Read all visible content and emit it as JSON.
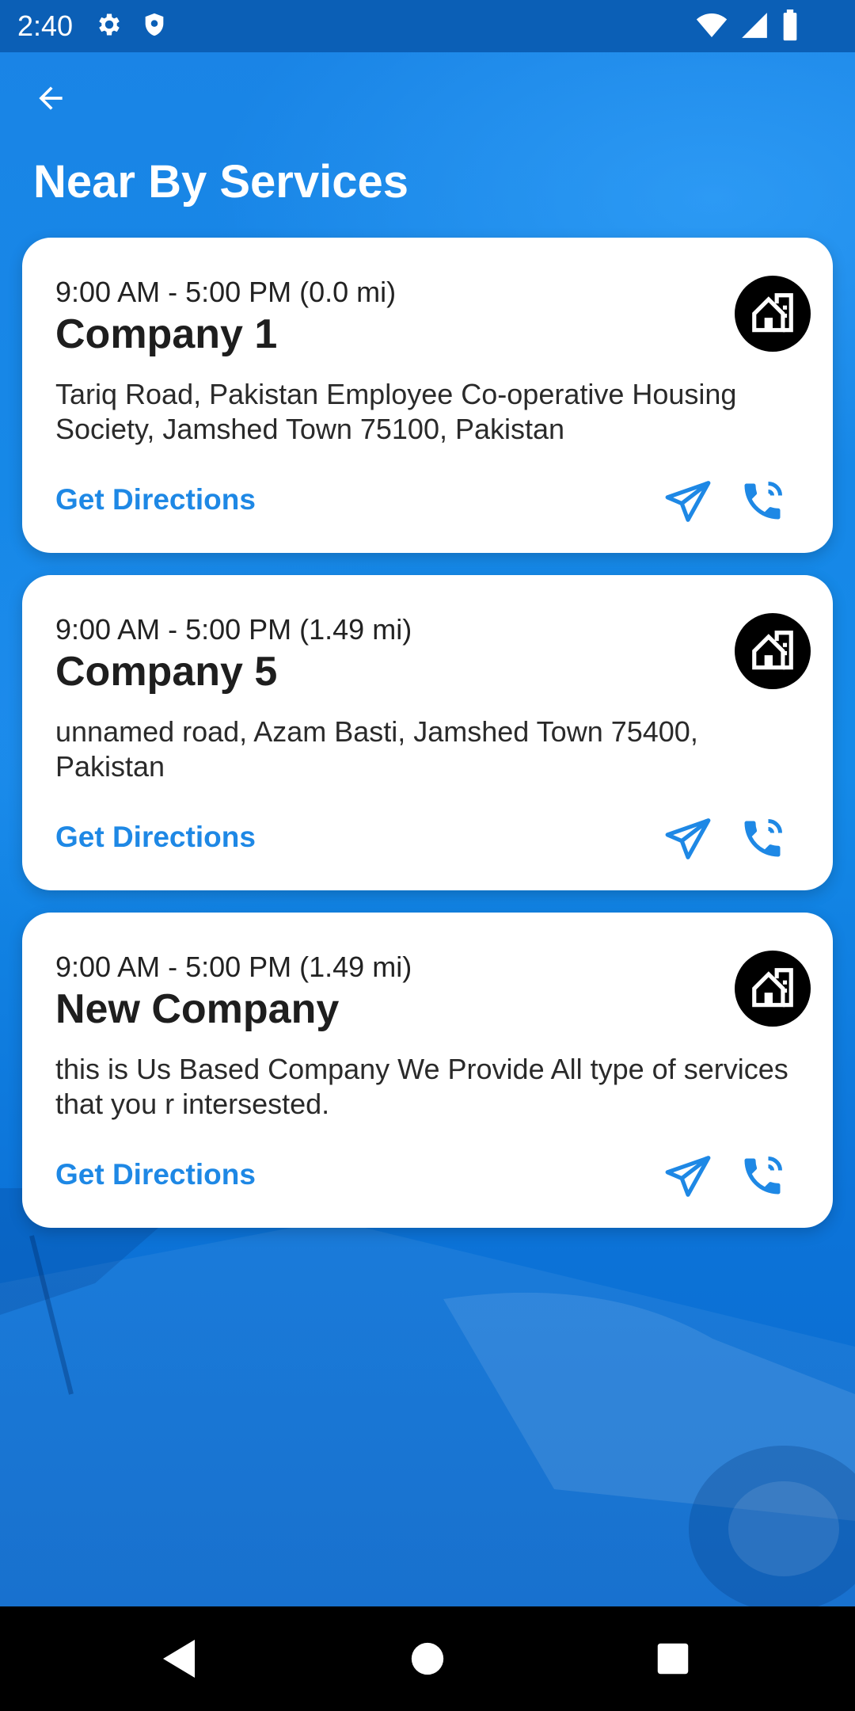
{
  "status_bar": {
    "time": "2:40",
    "left_icons": [
      "gear-icon",
      "shield-icon"
    ],
    "right_icons": [
      "wifi-icon",
      "signal-icon",
      "battery-icon"
    ]
  },
  "header": {
    "back_icon": "arrow-left-icon",
    "title": "Near By Services"
  },
  "services": [
    {
      "hours": "9:00 AM - 5:00 PM (0.0 mi)",
      "name": "Company 1",
      "address": "Tariq Road, Pakistan Employee Co-operative Housing Society, Jamshed Town 75100, Pakistan",
      "directions_label": "Get Directions"
    },
    {
      "hours": "9:00 AM - 5:00 PM (1.49 mi)",
      "name": "Company 5",
      "address": "unnamed road, Azam Basti, Jamshed Town 75400, Pakistan",
      "directions_label": "Get Directions"
    },
    {
      "hours": "9:00 AM - 5:00 PM (1.49 mi)",
      "name": "New Company",
      "address": "this is Us Based Company We Provide All type of services that you r intersested.",
      "directions_label": "Get Directions"
    }
  ],
  "card_icons": {
    "company": "building-icon",
    "send": "paper-plane-icon",
    "call": "phone-call-icon"
  },
  "colors": {
    "accent": "#1e88e5",
    "status_bar": "#0b5fb6",
    "card": "#ffffff",
    "nav_bar": "#000000"
  },
  "nav_bar": [
    "back-triangle-icon",
    "home-circle-icon",
    "recents-square-icon"
  ]
}
